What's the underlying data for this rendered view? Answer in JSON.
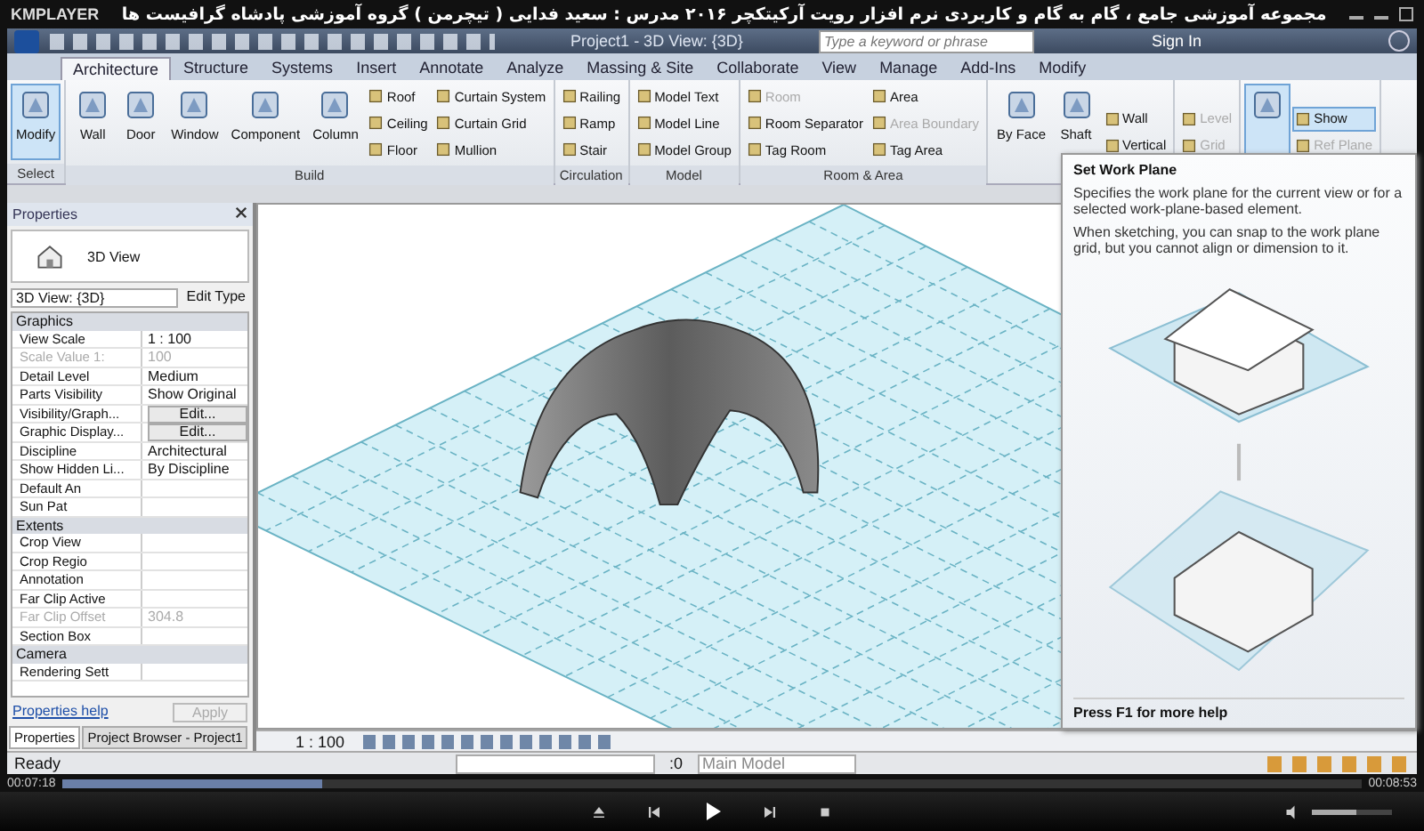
{
  "player": {
    "logo": "KMPLAYER",
    "title": "مجموعه آموزشی جامع ، گام به گام و کاربردی نرم افزار رویت آرکیتکچر ۲۰۱۶ مدرس : سعید فدایی ( تیچرمن ) گروه آموزشی پادشاه گرافیست ها",
    "elapsed": "00:07:18",
    "total": "00:08:53",
    "progress": {
      "level": 0.2
    },
    "volume": {
      "level": 0.55
    }
  },
  "app": {
    "title": "Project1 - 3D View: {3D}",
    "search": {
      "placeholder": "Type a keyword or phrase"
    },
    "sign_in": "Sign In"
  },
  "tabs": [
    {
      "label": "Architecture",
      "selected": true
    },
    {
      "label": "Structure",
      "selected": false
    },
    {
      "label": "Systems",
      "selected": false
    },
    {
      "label": "Insert",
      "selected": false
    },
    {
      "label": "Annotate",
      "selected": false
    },
    {
      "label": "Analyze",
      "selected": false
    },
    {
      "label": "Massing & Site",
      "selected": false
    },
    {
      "label": "Collaborate",
      "selected": false
    },
    {
      "label": "View",
      "selected": false
    },
    {
      "label": "Manage",
      "selected": false
    },
    {
      "label": "Add-Ins",
      "selected": false
    },
    {
      "label": "Modify",
      "selected": false
    }
  ],
  "ribbon": [
    {
      "label": "Select",
      "items": [
        {
          "label": "Modify",
          "kind": "large",
          "selected": true,
          "disabled": false
        }
      ]
    },
    {
      "label": "Build",
      "items": [
        {
          "label": "Wall",
          "kind": "large",
          "selected": false,
          "disabled": false
        },
        {
          "label": "Door",
          "kind": "large",
          "selected": false,
          "disabled": false
        },
        {
          "label": "Window",
          "kind": "large",
          "selected": false,
          "disabled": false
        },
        {
          "label": "Component",
          "kind": "large",
          "selected": false,
          "disabled": false
        },
        {
          "label": "Column",
          "kind": "large",
          "selected": false,
          "disabled": false
        },
        {
          "label": "Roof",
          "kind": "small",
          "selected": false,
          "disabled": false
        },
        {
          "label": "Ceiling",
          "kind": "small",
          "selected": false,
          "disabled": false
        },
        {
          "label": "Floor",
          "kind": "small",
          "selected": false,
          "disabled": false
        },
        {
          "label": "Curtain System",
          "kind": "small",
          "selected": false,
          "disabled": false
        },
        {
          "label": "Curtain Grid",
          "kind": "small",
          "selected": false,
          "disabled": false
        },
        {
          "label": "Mullion",
          "kind": "small",
          "selected": false,
          "disabled": false
        }
      ]
    },
    {
      "label": "Circulation",
      "items": [
        {
          "label": "Railing",
          "kind": "small",
          "selected": false,
          "disabled": false
        },
        {
          "label": "Ramp",
          "kind": "small",
          "selected": false,
          "disabled": false
        },
        {
          "label": "Stair",
          "kind": "small",
          "selected": false,
          "disabled": false
        }
      ]
    },
    {
      "label": "Model",
      "items": [
        {
          "label": "Model Text",
          "kind": "small",
          "selected": false,
          "disabled": false
        },
        {
          "label": "Model Line",
          "kind": "small",
          "selected": false,
          "disabled": false
        },
        {
          "label": "Model Group",
          "kind": "small",
          "selected": false,
          "disabled": false
        }
      ]
    },
    {
      "label": "Room & Area",
      "items": [
        {
          "label": "Room",
          "kind": "small",
          "selected": false,
          "disabled": true
        },
        {
          "label": "Room Separator",
          "kind": "small",
          "selected": false,
          "disabled": false
        },
        {
          "label": "Tag Room",
          "kind": "small",
          "selected": false,
          "disabled": false
        },
        {
          "label": "Area",
          "kind": "small",
          "selected": false,
          "disabled": false
        },
        {
          "label": "Area Boundary",
          "kind": "small",
          "selected": false,
          "disabled": true
        },
        {
          "label": "Tag Area",
          "kind": "small",
          "selected": false,
          "disabled": false
        }
      ]
    },
    {
      "items": [
        {
          "label": "By Face",
          "kind": "large",
          "selected": false,
          "disabled": false
        },
        {
          "label": "Shaft",
          "kind": "large",
          "selected": false,
          "disabled": false
        },
        {
          "label": "Wall",
          "kind": "small",
          "selected": false,
          "disabled": false
        },
        {
          "label": "Vertical",
          "kind": "small",
          "selected": false,
          "disabled": false
        }
      ]
    },
    {
      "items": [
        {
          "label": "Level",
          "kind": "small",
          "selected": false,
          "disabled": true
        },
        {
          "label": "Grid",
          "kind": "small",
          "selected": false,
          "disabled": true
        }
      ]
    },
    {
      "items": [
        {
          "kind": "large",
          "selected": true,
          "disabled": false
        },
        {
          "label": "Show",
          "kind": "small",
          "selected": true,
          "disabled": false
        },
        {
          "label": "Ref Plane",
          "kind": "small",
          "selected": false,
          "disabled": true
        }
      ]
    }
  ],
  "properties": {
    "title": "Properties",
    "type_name": "3D View",
    "view_selector": "3D View: {3D}",
    "edit_type": "Edit Type",
    "rows": [
      {
        "kind": "group",
        "label": "Graphics"
      },
      {
        "kind": "field",
        "label": "View Scale",
        "value": "1 : 100",
        "disabled": false
      },
      {
        "kind": "field",
        "label": "Scale Value    1:",
        "value": "100",
        "disabled": true
      },
      {
        "kind": "field",
        "label": "Detail Level",
        "value": "Medium",
        "disabled": false
      },
      {
        "kind": "field",
        "label": "Parts Visibility",
        "value": "Show Original",
        "disabled": false
      },
      {
        "kind": "button",
        "label": "Visibility/Graph...",
        "value": "Edit...",
        "disabled": false
      },
      {
        "kind": "button",
        "label": "Graphic Display...",
        "value": "Edit...",
        "disabled": false
      },
      {
        "kind": "field",
        "label": "Discipline",
        "value": "Architectural",
        "disabled": false
      },
      {
        "kind": "field",
        "label": "Show Hidden Li...",
        "value": "By Discipline",
        "disabled": false
      },
      {
        "kind": "field",
        "label": "Default An",
        "value": "",
        "disabled": false
      },
      {
        "kind": "field",
        "label": "Sun Pat",
        "value": "",
        "disabled": false
      },
      {
        "kind": "group",
        "label": "Extents"
      },
      {
        "kind": "field",
        "label": "Crop View",
        "value": "",
        "disabled": false
      },
      {
        "kind": "field",
        "label": "Crop Regio",
        "value": "",
        "disabled": false
      },
      {
        "kind": "field",
        "label": "Annotation",
        "value": "",
        "disabled": false
      },
      {
        "kind": "field",
        "label": "Far Clip Active",
        "value": "",
        "disabled": false
      },
      {
        "kind": "field",
        "label": "Far Clip Offset",
        "value": "304.8",
        "disabled": true
      },
      {
        "kind": "field",
        "label": "Section Box",
        "value": "",
        "disabled": false
      },
      {
        "kind": "group",
        "label": "Camera"
      },
      {
        "kind": "field",
        "label": "Rendering Sett",
        "value": "",
        "disabled": false
      }
    ],
    "help": "Properties help",
    "apply": "Apply",
    "tabs": [
      {
        "label": "Properties",
        "selected": true
      },
      {
        "label": "Project Browser - Project1",
        "selected": false
      }
    ]
  },
  "view_bar": {
    "scale": "1 : 100"
  },
  "tooltip": {
    "title": "Set Work Plane",
    "paragraphs": [
      "Specifies the work plane for the current view or for a selected work-plane-based element.",
      "When sketching, you can snap to the work plane grid, but you cannot align or dimension to it."
    ],
    "footer": "Press F1 for more help"
  },
  "status": {
    "text": "Ready",
    "count": ":0",
    "model": "Main Model"
  }
}
